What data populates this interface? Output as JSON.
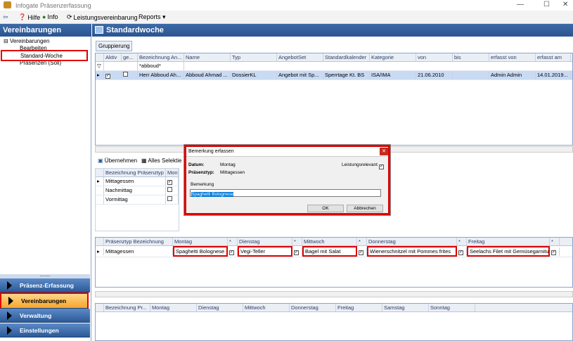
{
  "window": {
    "title": "Infogate Präsenzerfassung",
    "min": "—",
    "max": "☐",
    "close": "✕"
  },
  "menu": {
    "help": "Hilfe",
    "info": "Info",
    "lv": "Leistungsvereinbarung",
    "reports": "Reports ▾"
  },
  "left": {
    "header": "Vereinbarungen",
    "tree": {
      "root": "Vereinbarungen",
      "item1": "Bearbeiten",
      "item2": "Standard-Woche",
      "item3": "Präsenzen (Soll)"
    },
    "nav": [
      "Präsenz-Erfassung",
      "Vereinbarungen",
      "Verwaltung",
      "Einstellungen"
    ]
  },
  "main": {
    "header": "Standardwoche",
    "grouping": "Gruppierung",
    "top_grid": {
      "headers": [
        "Aktiv",
        "ge...",
        "Bezeichnung An...",
        "Name",
        "Typ",
        "AngebotSet",
        "Standardkalender",
        "Kategorie",
        "von",
        "bis",
        "erfasst von",
        "erfasst am"
      ],
      "filter": "*abboud*",
      "row": [
        "",
        "✓",
        "",
        "Herr Abboud Ah...",
        "Abboud Ahmad ...",
        "DossierKL",
        "Angebot mit Sp...",
        "Sperrtage Kt. BS",
        "ISA/IMA",
        "21.06.2010",
        "",
        "Admin Admin",
        "14.01.2019..."
      ]
    },
    "toolbar": {
      "apply": "Übernehmen",
      "selectall": "Alles Selektie"
    },
    "mid_grid": {
      "headers": [
        "Bezeichnung Präsenztyp",
        "Montag"
      ],
      "rows": [
        "Mittagessen",
        "Nachmittag",
        "Vormittag"
      ]
    },
    "week_grid": {
      "headers": [
        "Präsenztyp Bezeichnung",
        "Montag",
        "*",
        "Dienstag",
        "*",
        "Mittwoch",
        "*",
        "Donnerstag",
        "*",
        "Freitag",
        "*"
      ],
      "row": {
        "type": "Mittagessen",
        "mo": "Spaghetti Bolognese",
        "di": "Vegi-Teller",
        "mi": "Bagel mit Salat",
        "do": "Wienerschnitzel mit Pommes frites",
        "fr": "Seelachs Filet mit Gemüsegarnitur"
      }
    },
    "bottom_grid": {
      "headers": [
        "Bezeichnung Pr...",
        "Montag",
        "Dienstag",
        "Mittwoch",
        "Donnerstag",
        "Freitag",
        "Samstag",
        "Sonntag"
      ]
    }
  },
  "dialog": {
    "title": "Bemerkung erfassen",
    "datum_label": "Datum:",
    "datum": "Montag",
    "typ_label": "Präsenztyp:",
    "typ": "Mittagessen",
    "relevant": "Leistungsrelevant",
    "bem_label": "Bemerkung",
    "bem": "Spaghetti Bolognese",
    "ok": "OK",
    "cancel": "Abbrechen"
  },
  "colors": {
    "header_blue": "#2a5591",
    "highlight": "#e00000",
    "active_nav": "#f6a52b"
  }
}
